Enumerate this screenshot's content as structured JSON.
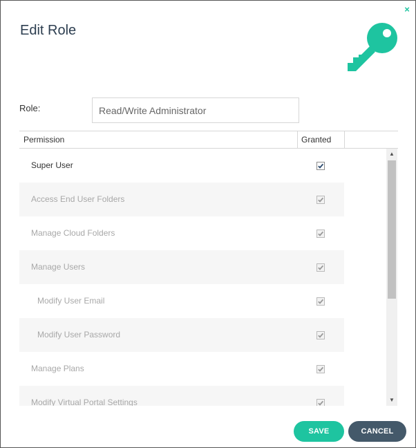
{
  "dialog": {
    "title": "Edit Role",
    "close_glyph": "×",
    "icon": "key-icon",
    "accent_color": "#1ec4a0",
    "cancel_color": "#44596a"
  },
  "role": {
    "label": "Role:",
    "value": "Read/Write Administrator"
  },
  "grid": {
    "columns": [
      "Permission",
      "Granted"
    ],
    "rows": [
      {
        "label": "Super User",
        "granted": true,
        "enabled": true,
        "indent": false
      },
      {
        "label": "Access End User Folders",
        "granted": true,
        "enabled": false,
        "indent": false
      },
      {
        "label": "Manage Cloud Folders",
        "granted": true,
        "enabled": false,
        "indent": false
      },
      {
        "label": "Manage Users",
        "granted": true,
        "enabled": false,
        "indent": false
      },
      {
        "label": "Modify User Email",
        "granted": true,
        "enabled": false,
        "indent": true
      },
      {
        "label": "Modify User Password",
        "granted": true,
        "enabled": false,
        "indent": true
      },
      {
        "label": "Manage Plans",
        "granted": true,
        "enabled": false,
        "indent": false
      },
      {
        "label": "Modify Virtual Portal Settings",
        "granted": true,
        "enabled": false,
        "indent": false
      }
    ]
  },
  "buttons": {
    "save": "SAVE",
    "cancel": "CANCEL"
  }
}
